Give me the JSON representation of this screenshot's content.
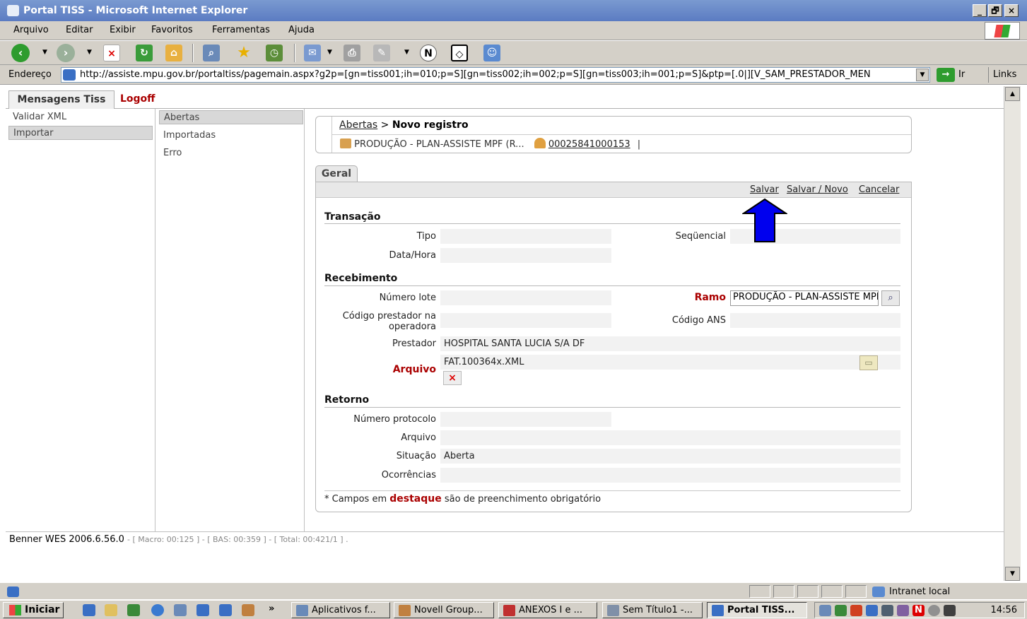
{
  "window": {
    "title": "Portal TISS - Microsoft Internet Explorer",
    "min": "_",
    "max": "🗗",
    "close": "×"
  },
  "menu": [
    "Arquivo",
    "Editar",
    "Exibir",
    "Favoritos",
    "Ferramentas",
    "Ajuda"
  ],
  "address": {
    "label": "Endereço",
    "url": "http://assiste.mpu.gov.br/portaltiss/pagemain.aspx?g2p=[gn=tiss001;ih=010;p=S][gn=tiss002;ih=002;p=S][gn=tiss003;ih=001;p=S]&ptp=[.0|][V_SAM_PRESTADOR_MEN",
    "go": "Ir",
    "links": "Links"
  },
  "tabs": {
    "main": "Mensagens Tiss",
    "logoff": "Logoff"
  },
  "leftnav": [
    "Validar XML",
    "Importar"
  ],
  "midnav": [
    "Abertas",
    "Importadas",
    "Erro"
  ],
  "breadcrumb": {
    "link": "Abertas",
    "sep": ">",
    "current": "Novo registro",
    "context": "PRODUÇÃO - PLAN-ASSISTE MPF (R...",
    "provider_code": "00025841000153",
    "pipe": "|"
  },
  "form_tab": "Geral",
  "actions": {
    "save": "Salvar",
    "save_new": "Salvar / Novo",
    "cancel": "Cancelar"
  },
  "sections": {
    "transacao": {
      "title": "Transação",
      "tipo_label": "Tipo",
      "tipo": "",
      "sequencial_label": "Seqüencial",
      "sequencial": "",
      "datahora_label": "Data/Hora",
      "datahora": ""
    },
    "recebimento": {
      "title": "Recebimento",
      "lote_label": "Número lote",
      "lote": "",
      "ramo_label": "Ramo",
      "ramo": "PRODUÇÃO - PLAN-ASSISTE MPF",
      "codprest_label_1": "Código prestador na",
      "codprest_label_2": "operadora",
      "codprest": "",
      "ans_label": "Código ANS",
      "ans": "",
      "prestador_label": "Prestador",
      "prestador": "HOSPITAL SANTA LUCIA S/A DF",
      "arquivo_label": "Arquivo",
      "arquivo": "FAT.100364x.XML"
    },
    "retorno": {
      "title": "Retorno",
      "protocolo_label": "Número protocolo",
      "protocolo": "",
      "arquivo_label": "Arquivo",
      "arquivo": "",
      "situacao_label": "Situação",
      "situacao": "Aberta",
      "ocorrencias_label": "Ocorrências",
      "ocorrencias": ""
    }
  },
  "footer": {
    "prefix": "* Campos em",
    "highlight": "destaque",
    "suffix": "são de preenchimento obrigatório"
  },
  "status": {
    "version": "Benner WES 2006.6.56.0",
    "timings": "- [ Macro: 00:125 ] - [ BAS: 00:359 ] - [ Total: 00:421/1 ] ."
  },
  "iestatus": {
    "zone": "Intranet local"
  },
  "taskbar": {
    "start": "Iniciar",
    "more": "»",
    "tasks": [
      "Aplicativos f...",
      "Novell Group...",
      "ANEXOS I e ...",
      "Sem Título1 -...",
      "Portal TISS..."
    ],
    "clock": "14:56"
  },
  "colors": {
    "required": "#aa0000",
    "annotation_arrow": "#0000ee",
    "titlebar": "#5b7cc2"
  }
}
